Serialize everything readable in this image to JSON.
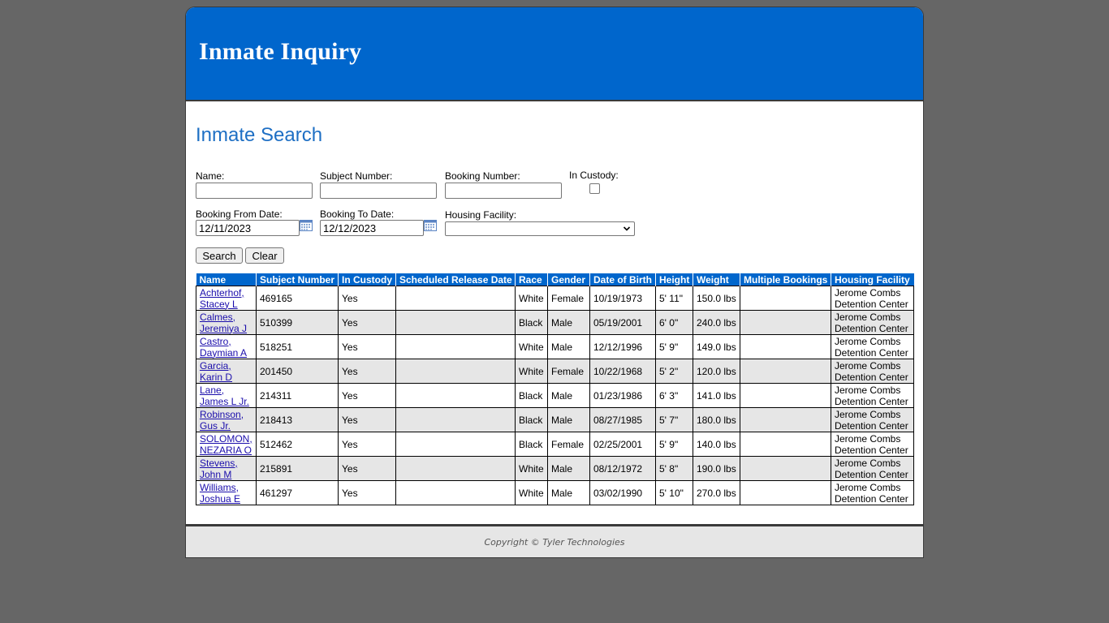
{
  "app": {
    "title": "Inmate Inquiry"
  },
  "search": {
    "title": "Inmate Search",
    "name_label": "Name:",
    "name_value": "",
    "subject_label": "Subject Number:",
    "subject_value": "",
    "booking_label": "Booking Number:",
    "booking_value": "",
    "custody_label": "In Custody:",
    "custody_checked": false,
    "from_label": "Booking From Date:",
    "from_value": "12/11/2023",
    "to_label": "Booking To Date:",
    "to_value": "12/12/2023",
    "facility_label": "Housing Facility:",
    "facility_value": "",
    "search_button": "Search",
    "clear_button": "Clear"
  },
  "table": {
    "headers": [
      "Name",
      "Subject Number",
      "In Custody",
      "Scheduled Release Date",
      "Race",
      "Gender",
      "Date of Birth",
      "Height",
      "Weight",
      "Multiple Bookings",
      "Housing Facility"
    ],
    "rows": [
      {
        "name_1": "Achterhof,",
        "name_2": "Stacey L",
        "subject": "469165",
        "custody": "Yes",
        "release": "",
        "race": "White",
        "gender": "Female",
        "dob": "10/19/1973",
        "height": "5' 11\"",
        "weight": "150.0 lbs",
        "multiple": "",
        "facility_1": "Jerome Combs",
        "facility_2": "Detention Center"
      },
      {
        "name_1": "Calmes,",
        "name_2": "Jeremiya J",
        "subject": "510399",
        "custody": "Yes",
        "release": "",
        "race": "Black",
        "gender": "Male",
        "dob": "05/19/2001",
        "height": "6' 0\"",
        "weight": "240.0 lbs",
        "multiple": "",
        "facility_1": "Jerome Combs",
        "facility_2": "Detention Center"
      },
      {
        "name_1": "Castro,",
        "name_2": "Daymian A",
        "subject": "518251",
        "custody": "Yes",
        "release": "",
        "race": "White",
        "gender": "Male",
        "dob": "12/12/1996",
        "height": "5' 9\"",
        "weight": "149.0 lbs",
        "multiple": "",
        "facility_1": "Jerome Combs",
        "facility_2": "Detention Center"
      },
      {
        "name_1": "Garcia,",
        "name_2": "Karin D",
        "subject": "201450",
        "custody": "Yes",
        "release": "",
        "race": "White",
        "gender": "Female",
        "dob": "10/22/1968",
        "height": "5' 2\"",
        "weight": "120.0 lbs",
        "multiple": "",
        "facility_1": "Jerome Combs",
        "facility_2": "Detention Center"
      },
      {
        "name_1": "Lane,",
        "name_2": "James L Jr.",
        "subject": "214311",
        "custody": "Yes",
        "release": "",
        "race": "Black",
        "gender": "Male",
        "dob": "01/23/1986",
        "height": "6' 3\"",
        "weight": "141.0 lbs",
        "multiple": "",
        "facility_1": "Jerome Combs",
        "facility_2": "Detention Center"
      },
      {
        "name_1": "Robinson,",
        "name_2": "Gus Jr.",
        "subject": "218413",
        "custody": "Yes",
        "release": "",
        "race": "Black",
        "gender": "Male",
        "dob": "08/27/1985",
        "height": "5' 7\"",
        "weight": "180.0 lbs",
        "multiple": "",
        "facility_1": "Jerome Combs",
        "facility_2": "Detention Center"
      },
      {
        "name_1": "SOLOMON,",
        "name_2": "NEZARIA O",
        "subject": "512462",
        "custody": "Yes",
        "release": "",
        "race": "Black",
        "gender": "Female",
        "dob": "02/25/2001",
        "height": "5' 9\"",
        "weight": "140.0 lbs",
        "multiple": "",
        "facility_1": "Jerome Combs",
        "facility_2": "Detention Center"
      },
      {
        "name_1": "Stevens,",
        "name_2": "John M",
        "subject": "215891",
        "custody": "Yes",
        "release": "",
        "race": "White",
        "gender": "Male",
        "dob": "08/12/1972",
        "height": "5' 8\"",
        "weight": "190.0 lbs",
        "multiple": "",
        "facility_1": "Jerome Combs",
        "facility_2": "Detention Center"
      },
      {
        "name_1": "Williams,",
        "name_2": "Joshua E",
        "subject": "461297",
        "custody": "Yes",
        "release": "",
        "race": "White",
        "gender": "Male",
        "dob": "03/02/1990",
        "height": "5' 10\"",
        "weight": "270.0 lbs",
        "multiple": "",
        "facility_1": "Jerome Combs",
        "facility_2": "Detention Center"
      }
    ]
  },
  "footer": {
    "copyright": "Copyright © Tyler Technologies"
  },
  "colors": {
    "banner": "#0066cc",
    "title": "#1e6fc4",
    "background": "#666666",
    "row_alt": "#e6e6e6",
    "link": "#1a0dab"
  },
  "icons": {
    "calendar": "calendar-icon",
    "dropdown": "chevron-down-icon"
  }
}
